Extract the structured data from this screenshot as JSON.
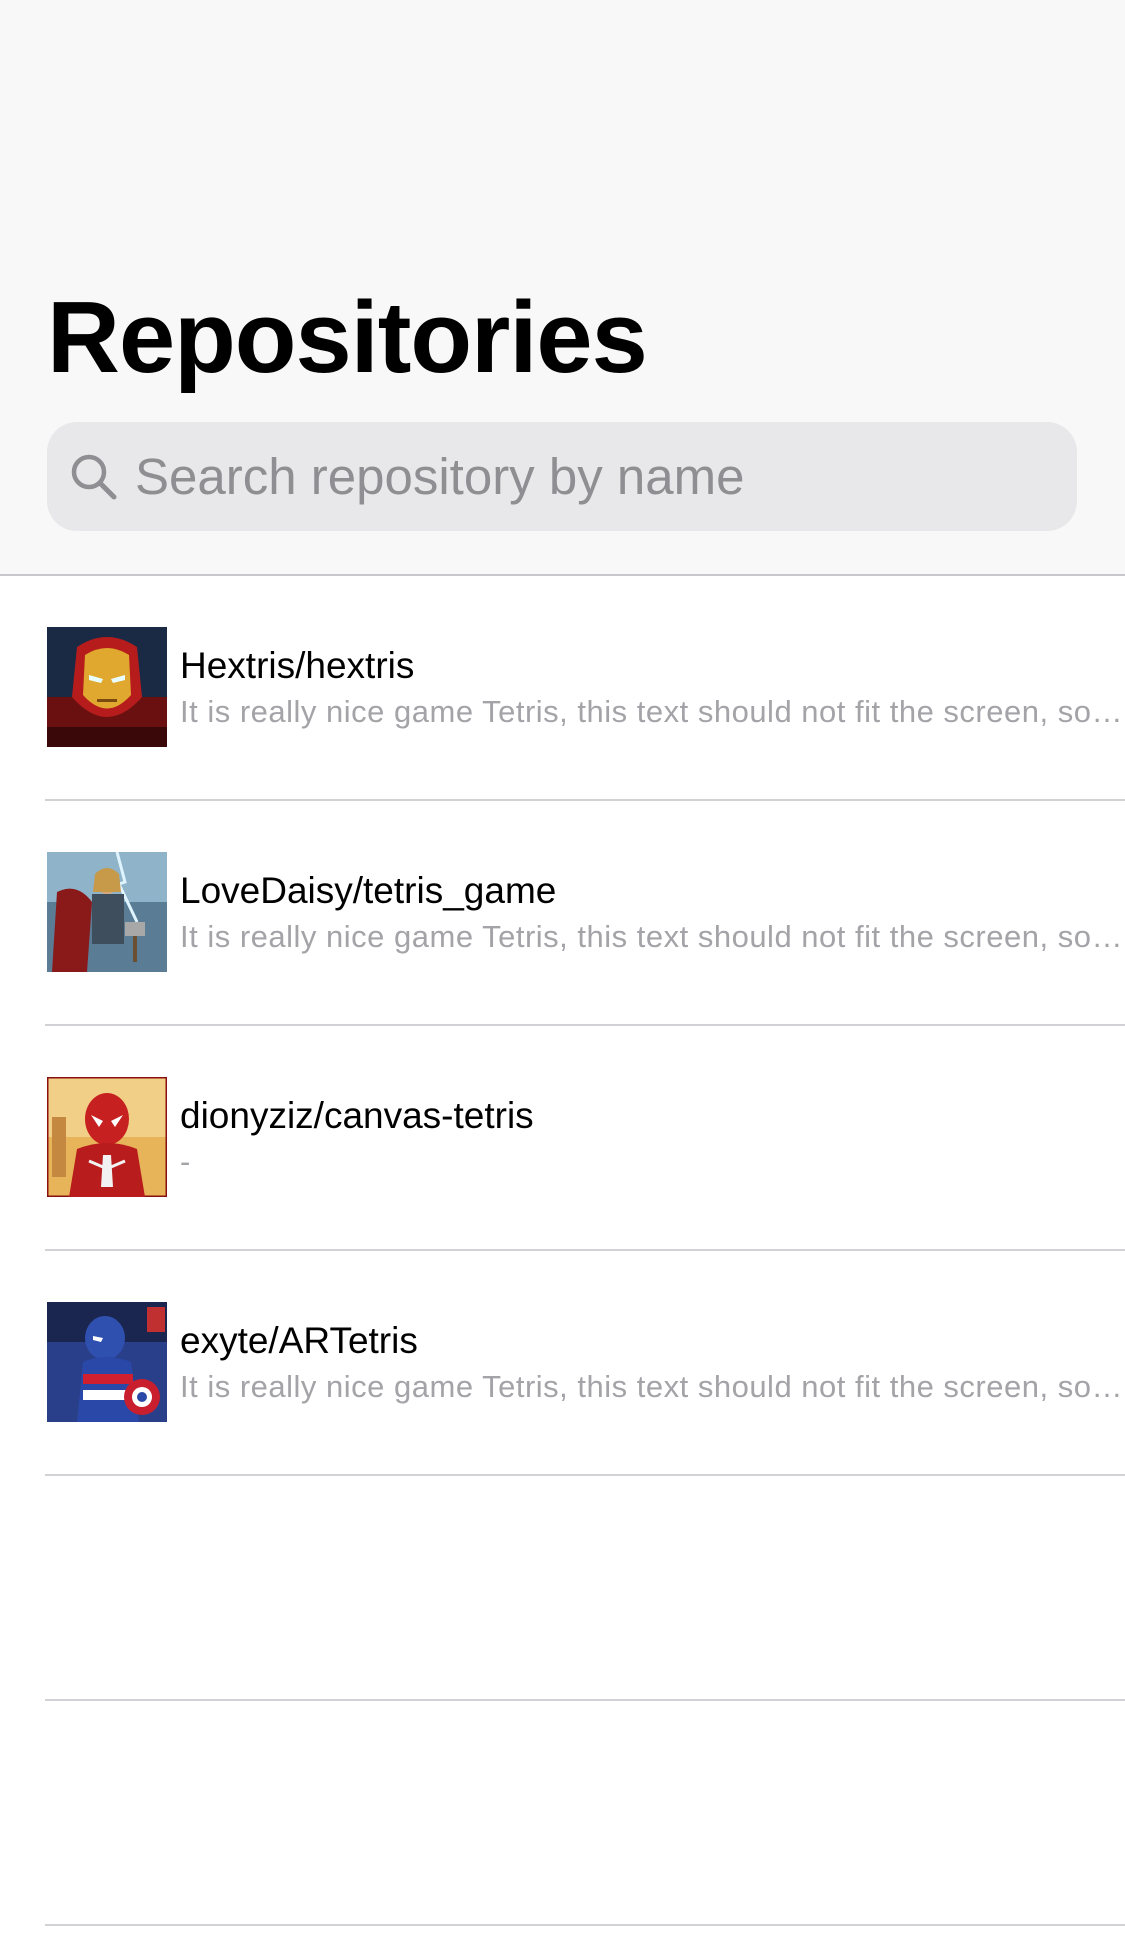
{
  "header": {
    "title": "Repositories"
  },
  "search": {
    "placeholder": "Search repository by name",
    "value": "",
    "icon": "search-icon"
  },
  "repositories": [
    {
      "name": "Hextris/hextris",
      "description": "It is really nice game Tetris, this text should not fit the screen, so it should be truncated",
      "avatar_icon": "iron-man-avatar"
    },
    {
      "name": "LoveDaisy/tetris_game",
      "description": "It is really nice game Tetris, this text should not fit the screen, so it should be truncated",
      "avatar_icon": "thor-avatar"
    },
    {
      "name": "dionyziz/canvas-tetris",
      "description": "-",
      "avatar_icon": "spider-man-avatar"
    },
    {
      "name": "exyte/ARTetris",
      "description": "It is really nice game Tetris, this text should not fit the screen, so it should be truncated",
      "avatar_icon": "captain-america-avatar"
    }
  ],
  "colors": {
    "header_background": "#f8f8f8",
    "search_background": "#e8e8ea",
    "placeholder": "#8e8e93",
    "separator": "#d1d1d6",
    "description": "#a4a4a8"
  }
}
